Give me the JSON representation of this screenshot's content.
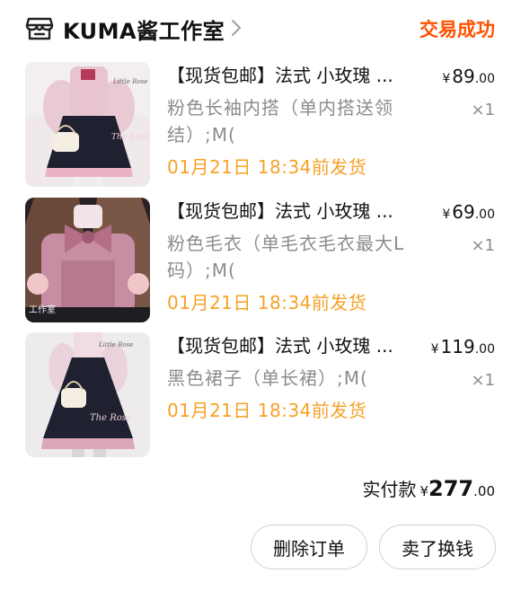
{
  "shop": {
    "name": "KUMA酱工作室",
    "status": "交易成功",
    "icons": {
      "shop": "shop-icon",
      "chevron": "chevron-right-icon"
    }
  },
  "items": [
    {
      "title": "【现货包邮】法式 小玫瑰 ...",
      "spec": "粉色长袖内搭（单内搭送领结）;M(",
      "ship": "01月21日 18:34前发货",
      "price_currency": "¥",
      "price_int": "89",
      "price_dec": ".00",
      "qty": "×1",
      "image_text": "Little Rose"
    },
    {
      "title": "【现货包邮】法式 小玫瑰 ...",
      "spec": "粉色毛衣（单毛衣毛衣最大L码）;M(",
      "ship": "01月21日 18:34前发货",
      "price_currency": "¥",
      "price_int": "69",
      "price_dec": ".00",
      "qty": "×1",
      "image_text": "工作室"
    },
    {
      "title": "【现货包邮】法式 小玫瑰 ...",
      "spec": "黑色裙子（单长裙）;M(",
      "ship": "01月21日 18:34前发货",
      "price_currency": "¥",
      "price_int": "119",
      "price_dec": ".00",
      "qty": "×1",
      "image_text": "Little Rose"
    }
  ],
  "total": {
    "label": "实付款",
    "currency": "¥",
    "int": "277",
    "dec": ".00"
  },
  "actions": {
    "delete_label": "删除订单",
    "sell_label": "卖了换钱"
  },
  "colors": {
    "accent": "#ff5000",
    "ship": "#f7a127",
    "muted": "#8c8c8c"
  }
}
